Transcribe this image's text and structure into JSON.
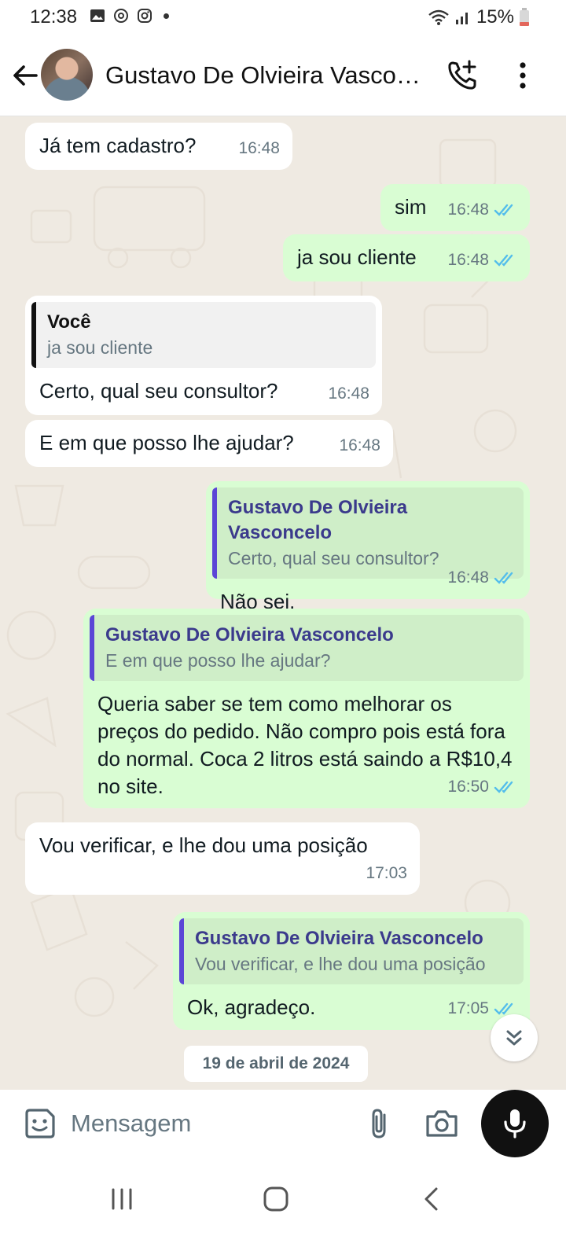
{
  "status_bar": {
    "time": "12:38",
    "battery": "15%"
  },
  "header": {
    "contact_name": "Gustavo De Olvieira Vascon..."
  },
  "messages": [
    {
      "dir": "in",
      "text": "Já tem cadastro?",
      "time": "16:48"
    },
    {
      "dir": "out",
      "text": "sim",
      "time": "16:48"
    },
    {
      "dir": "out",
      "text": "ja sou cliente",
      "time": "16:48"
    },
    {
      "dir": "in",
      "quote_author": "Você",
      "quote_text": "ja sou cliente",
      "text": "Certo, qual seu consultor?",
      "time": "16:48"
    },
    {
      "dir": "in",
      "text": "E em que posso lhe ajudar?",
      "time": "16:48"
    },
    {
      "dir": "out",
      "quote_author": "Gustavo De Olvieira Vasconcelo",
      "quote_text": "Certo, qual seu consultor?",
      "text": "Não sei.",
      "time": "16:48"
    },
    {
      "dir": "out",
      "quote_author": "Gustavo De Olvieira Vasconcelo",
      "quote_text": "E em que posso lhe ajudar?",
      "text": "Queria saber se tem como melhorar os preços do pedido. Não compro pois está fora do normal. Coca 2 litros está saindo a R$10,4 no site.",
      "time": "16:50"
    },
    {
      "dir": "in",
      "text": "Vou verificar, e lhe dou uma posição",
      "time": "17:03"
    },
    {
      "dir": "out",
      "quote_author": "Gustavo De Olvieira Vasconcelo",
      "quote_text": "Vou verificar, e lhe dou uma posição",
      "text": "Ok, agradeço.",
      "time": "17:05"
    }
  ],
  "date_chip": "19 de abril de 2024",
  "input": {
    "placeholder": "Mensagem"
  },
  "colors": {
    "chat_bg": "#efeae2",
    "outgoing_bubble": "#d9fdd3",
    "incoming_bubble": "#ffffff",
    "read_ticks": "#53bdeb",
    "quote_bar": "#5b45d6"
  },
  "icons": [
    "back-arrow-icon",
    "add-call-icon",
    "more-vert-icon",
    "emoji-icon",
    "attach-icon",
    "camera-icon",
    "mic-icon",
    "double-chevron-down-icon"
  ]
}
